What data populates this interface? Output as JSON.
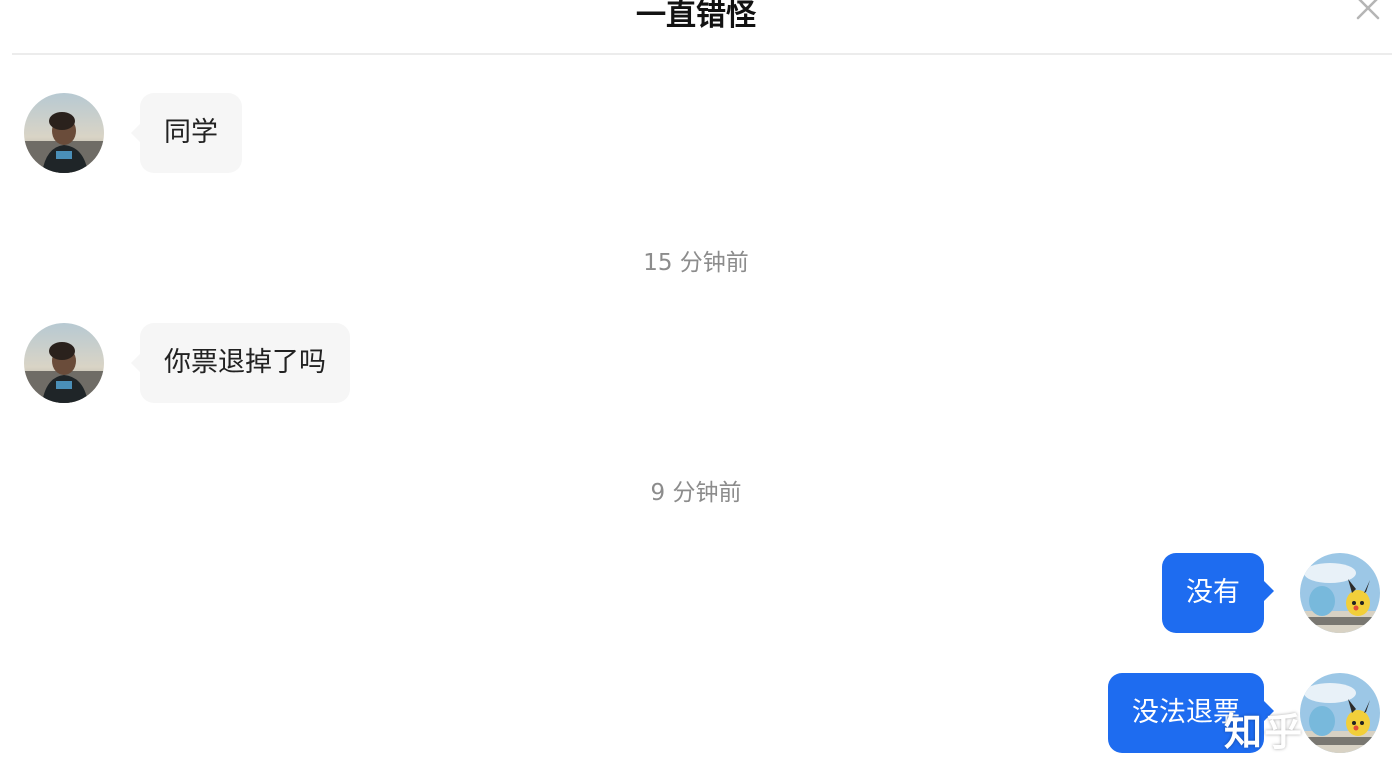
{
  "header": {
    "title": "一直错怪"
  },
  "icons": {
    "close": "close-icon"
  },
  "colors": {
    "outgoing_bubble": "#1e6cf0",
    "incoming_bubble": "#f6f6f6",
    "timestamp_text": "#8c8c8c"
  },
  "messages": [
    {
      "direction": "incoming",
      "text": "同学"
    },
    {
      "direction": "incoming",
      "text": "你票退掉了吗"
    },
    {
      "direction": "outgoing",
      "text": "没有"
    },
    {
      "direction": "outgoing",
      "text": "没法退票"
    }
  ],
  "timestamps": [
    "15 分钟前",
    "9 分钟前"
  ],
  "watermark": "知乎"
}
